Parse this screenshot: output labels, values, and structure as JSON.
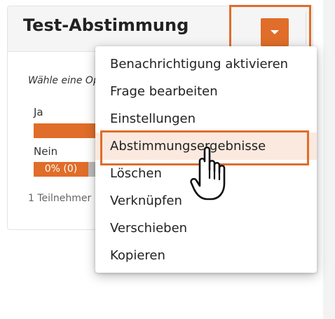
{
  "card": {
    "title": "Test-Abstimmung",
    "prompt": "Wähle eine Option",
    "participants": "1 Teilnehmer"
  },
  "results": {
    "options": [
      {
        "label": "Ja",
        "fill_fraction": 1.0
      },
      {
        "label": "Nein",
        "value_text": "0% (0)",
        "fill_fraction": 0.0
      }
    ]
  },
  "menu": {
    "items": [
      {
        "label": "Benachrichtigung aktivieren"
      },
      {
        "label": "Frage bearbeiten"
      },
      {
        "label": "Einstellungen"
      },
      {
        "label": "Abstimmungsergebnisse",
        "hovered": true
      },
      {
        "label": "Löschen"
      },
      {
        "label": "Verknüpfen"
      },
      {
        "label": "Verschieben"
      },
      {
        "label": "Kopieren"
      }
    ]
  },
  "icons": {
    "toggle": "caret-down-icon",
    "cursor": "hand-pointer-icon"
  },
  "colors": {
    "accent": "#e06d29",
    "hover_background": "#fbe9df",
    "bar_track": "#bdbdbd"
  }
}
